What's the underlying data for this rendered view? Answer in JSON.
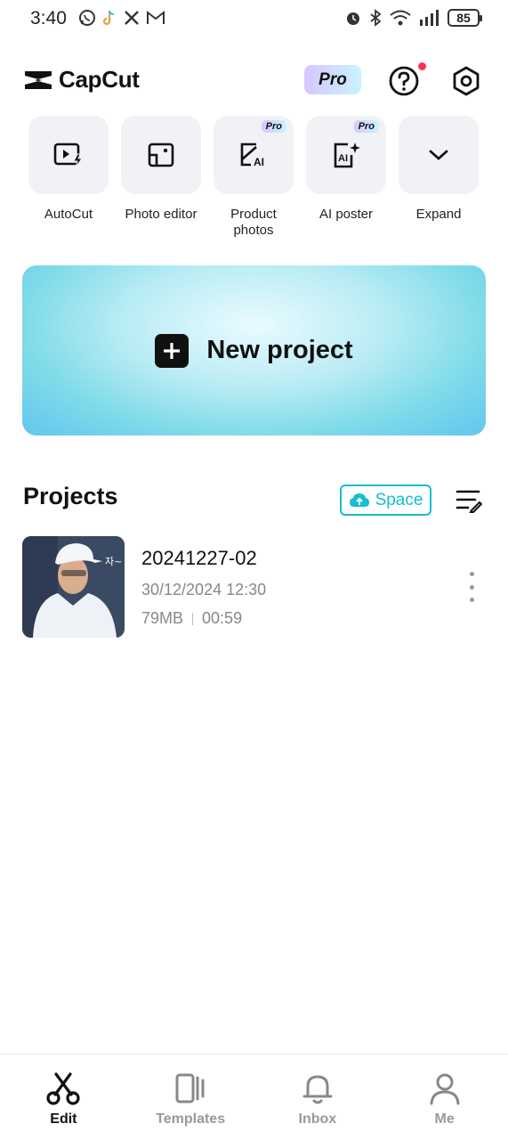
{
  "status_bar": {
    "time": "3:40",
    "left_icons": [
      "whatsapp-icon",
      "tiktok-icon",
      "x-icon",
      "gmail-icon"
    ],
    "right_icons": [
      "alarm-icon",
      "bluetooth-icon",
      "wifi-icon",
      "signal-icon"
    ],
    "battery": "85"
  },
  "header": {
    "app_name": "CapCut",
    "pro_label": "Pro",
    "notification_dot_color": "#ff3355"
  },
  "tools": [
    {
      "label": "AutoCut",
      "icon": "autocut-icon",
      "pro": false
    },
    {
      "label": "Photo editor",
      "icon": "photo-editor-icon",
      "pro": false
    },
    {
      "label": "Product photos",
      "icon": "product-photos-icon",
      "pro": true,
      "pro_label": "Pro"
    },
    {
      "label": "AI poster",
      "icon": "ai-poster-icon",
      "pro": true,
      "pro_label": "Pro"
    },
    {
      "label": "Expand",
      "icon": "chevron-down-icon",
      "pro": false
    }
  ],
  "new_project": {
    "label": "New project"
  },
  "projects": {
    "title": "Projects",
    "space_label": "Space",
    "accent_color": "#17bdd0",
    "items": [
      {
        "name": "20241227-02",
        "date": "30/12/2024 12:30",
        "size": "79MB",
        "duration": "00:59",
        "thumb_text": "자~"
      }
    ]
  },
  "bottom_nav": [
    {
      "label": "Edit",
      "icon": "scissors-icon",
      "active": true
    },
    {
      "label": "Templates",
      "icon": "templates-icon",
      "active": false
    },
    {
      "label": "Inbox",
      "icon": "bell-icon",
      "active": false
    },
    {
      "label": "Me",
      "icon": "person-icon",
      "active": false
    }
  ]
}
